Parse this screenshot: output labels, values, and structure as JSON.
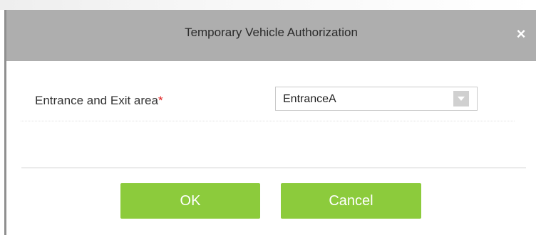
{
  "dialog": {
    "title": "Temporary Vehicle Authorization",
    "close_symbol": "×"
  },
  "form": {
    "label": "Entrance and Exit area",
    "required_mark": "*",
    "select_value": "EntranceA"
  },
  "buttons": {
    "ok_label": "OK",
    "cancel_label": "Cancel"
  },
  "colors": {
    "title_bar": "#aeaeae",
    "button_green": "#8ccb3c",
    "required_red": "#e02020"
  },
  "icons": {
    "close": "close-icon",
    "dropdown": "chevron-down-icon"
  }
}
